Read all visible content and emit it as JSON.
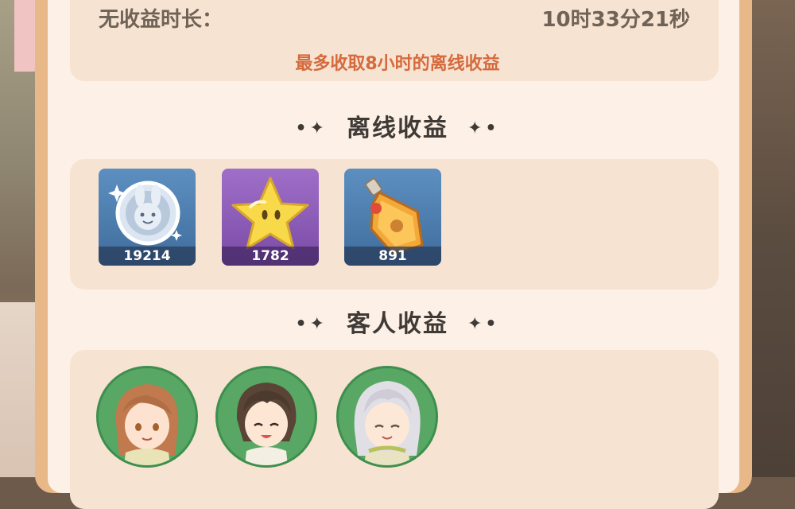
{
  "summary": {
    "no_income_label": "无收益时长：",
    "no_income_value": "10时33分21秒",
    "cap_note": "最多收取8小时的离线收益"
  },
  "offline_section": {
    "title": "离线收益",
    "items": [
      {
        "icon": "silver-rabbit-coin-icon",
        "count": "19214"
      },
      {
        "icon": "yellow-star-icon",
        "count": "1782"
      },
      {
        "icon": "potion-bottle-icon",
        "count": "891"
      }
    ]
  },
  "guest_section": {
    "title": "客人收益",
    "guests": [
      {
        "icon": "guest-brown-hair-avatar"
      },
      {
        "icon": "guest-dark-hair-avatar"
      },
      {
        "icon": "guest-silver-hair-avatar"
      }
    ]
  },
  "colors": {
    "panel_frame": "#e8b888",
    "panel_bg": "#fdf1e7",
    "card_bg": "#f7e3d2",
    "accent_note": "#d56a3c",
    "guest_ring": "#59a764"
  }
}
